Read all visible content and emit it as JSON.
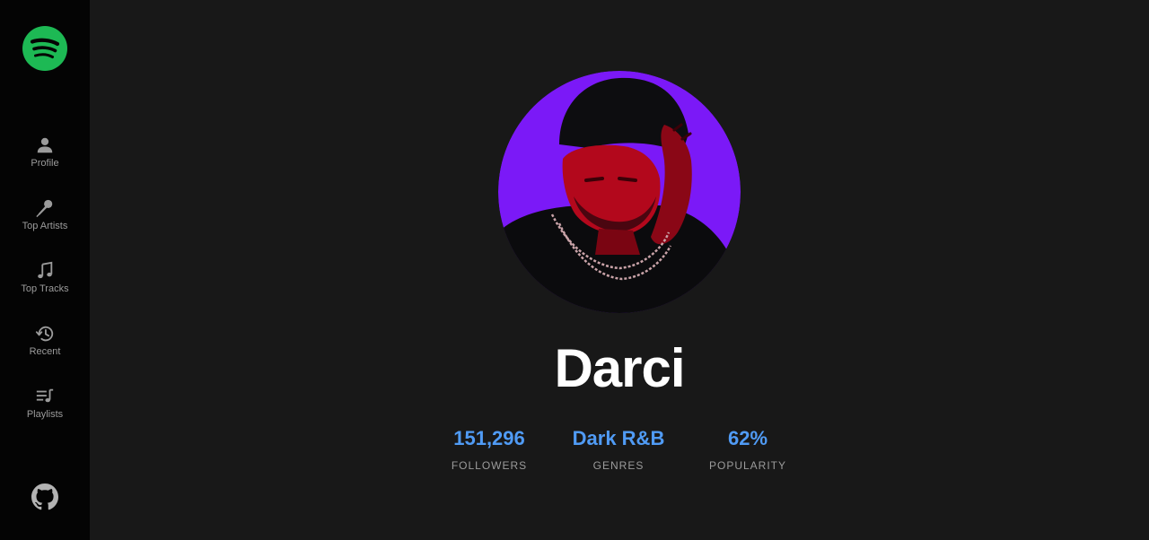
{
  "colors": {
    "background": "#181818",
    "sidebar": "#040404",
    "spotify_green": "#1DB954",
    "accent_blue": "#509bf5",
    "muted_text": "#9b9b9b",
    "avatar_bg": "#7b19f7"
  },
  "sidebar": {
    "logo_icon": "spotify-logo-icon",
    "items": [
      {
        "label": "Profile",
        "icon": "user-icon"
      },
      {
        "label": "Top Artists",
        "icon": "microphone-icon"
      },
      {
        "label": "Top Tracks",
        "icon": "music-note-icon"
      },
      {
        "label": "Recent",
        "icon": "history-icon"
      },
      {
        "label": "Playlists",
        "icon": "playlist-icon"
      }
    ],
    "footer_icon": "github-icon"
  },
  "artist": {
    "name": "Darci",
    "image_icon": "artist-photo",
    "stats": [
      {
        "value": "151,296",
        "label": "FOLLOWERS"
      },
      {
        "value": "Dark R&B",
        "label": "GENRES"
      },
      {
        "value": "62%",
        "label": "POPULARITY"
      }
    ]
  }
}
